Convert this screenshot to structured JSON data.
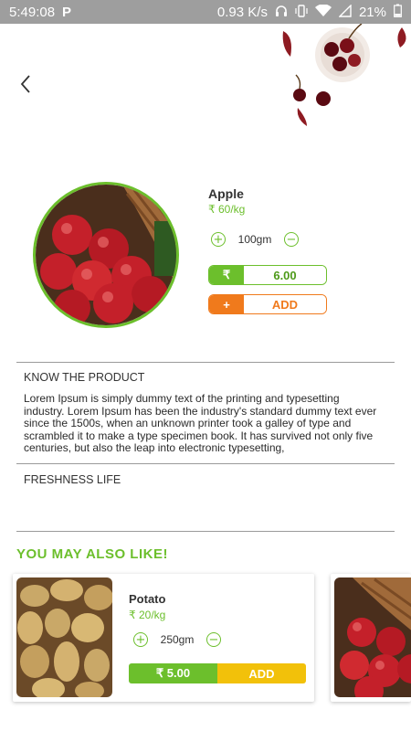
{
  "status_bar": {
    "time": "5:49:08",
    "app_icon": "P",
    "network_speed": "0.93 K/s",
    "battery": "21%",
    "icons": [
      "headphones-icon",
      "vibrate-icon",
      "wifi-icon",
      "signal-icon",
      "battery-icon"
    ]
  },
  "nav": {
    "back_icon": "chevron-left-icon"
  },
  "product": {
    "name": "Apple",
    "price": "₹ 60/kg",
    "quantity": "100gm",
    "total_symbol": "₹",
    "total_value": "6.00",
    "add_symbol": "+",
    "add_label": "ADD"
  },
  "sections": {
    "know_title": "KNOW THE PRODUCT",
    "know_text": "Lorem Ipsum is simply dummy text of the printing and typesetting industry. Lorem Ipsum has been the industry's standard dummy text ever since the 1500s, when an unknown printer took a galley of type and scrambled it to make a type specimen book. It has survived not only five centuries, but also the leap into electronic typesetting,",
    "freshness_title": "FRESHNESS LIFE"
  },
  "suggestions": {
    "heading": "YOU MAY ALSO LIKE!",
    "items": [
      {
        "name": "Potato",
        "price": "₹ 20/kg",
        "quantity": "250gm",
        "total": "₹ 5.00",
        "add_label": "ADD"
      }
    ]
  },
  "colors": {
    "green": "#6cbf2c",
    "orange": "#f07a1c",
    "yellow": "#f2c10a",
    "status_bar": "#9e9e9e"
  }
}
